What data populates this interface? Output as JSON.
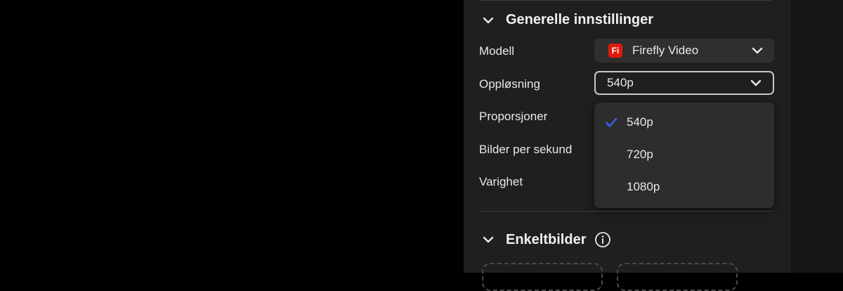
{
  "general_section": {
    "title": "Generelle innstillinger"
  },
  "model": {
    "label": "Modell",
    "value": "Firefly Video",
    "badge": "Fi"
  },
  "resolution": {
    "label": "Oppløsning",
    "value": "540p",
    "options": [
      {
        "label": "540p",
        "selected": true
      },
      {
        "label": "720p",
        "selected": false
      },
      {
        "label": "1080p",
        "selected": false
      }
    ]
  },
  "aspect_ratio": {
    "label": "Proporsjoner"
  },
  "fps": {
    "label": "Bilder per sekund"
  },
  "duration": {
    "label": "Varighet"
  },
  "keyframes_section": {
    "title": "Enkeltbilder"
  },
  "colors": {
    "accent_check": "#3b63f5",
    "badge_red": "#e01a0c"
  },
  "icons": [
    "chevron-down-icon",
    "firefly-badge-icon",
    "check-icon",
    "info-icon"
  ]
}
